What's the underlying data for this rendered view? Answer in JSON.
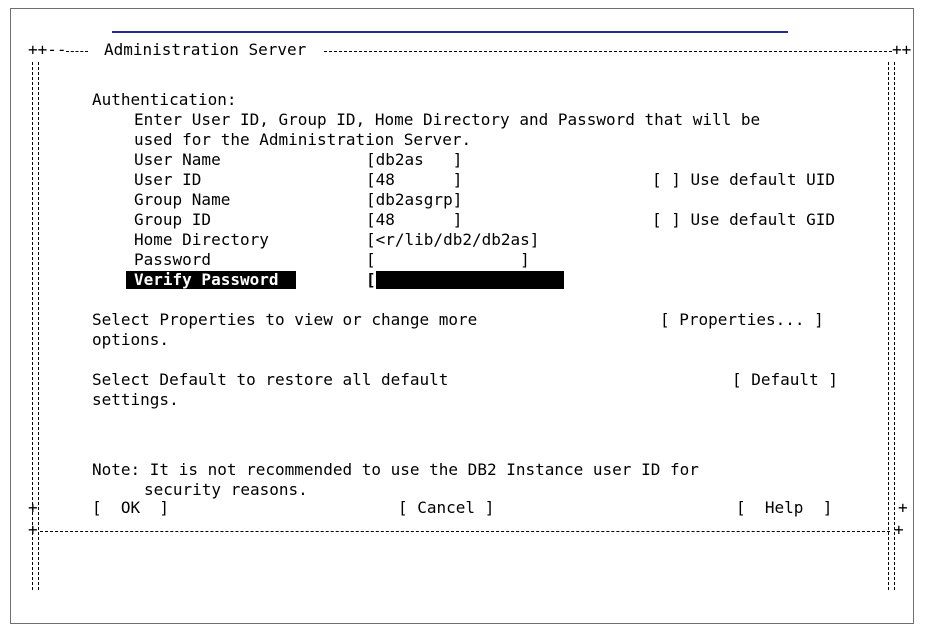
{
  "dialog": {
    "title": "Administration Server",
    "authentication": {
      "heading": "Authentication:",
      "description_line1": "Enter User ID, Group ID, Home Directory and Password that will be",
      "description_line2": "used for the Administration Server."
    },
    "fields": {
      "user_name": {
        "label": "User Name",
        "value": "[db2as   ]"
      },
      "user_id": {
        "label": "User ID",
        "value": "[48      ]"
      },
      "group_name": {
        "label": "Group Name",
        "value": "[db2asgrp]"
      },
      "group_id": {
        "label": "Group ID",
        "value": "[48      ]"
      },
      "home_directory": {
        "label": "Home Directory",
        "value": "[<r/lib/db2/db2as]"
      },
      "password": {
        "label": "Password",
        "value": "[               ]"
      },
      "verify_password": {
        "label": "Verify Password",
        "value": "[               ]"
      }
    },
    "checkboxes": {
      "default_uid": "[ ] Use default UID",
      "default_gid": "[ ] Use default GID"
    },
    "properties": {
      "text_line1": "Select Properties to view or change more",
      "text_line2": "options.",
      "button": "[ Properties... ]"
    },
    "default": {
      "text_line1": "Select Default to restore all default",
      "text_line2": "settings.",
      "button": "[ Default ]"
    },
    "note": {
      "line1": "Note: It is not recommended to use the DB2 Instance user ID for",
      "line2": "security reasons."
    },
    "buttons": {
      "ok": "[  OK  ]",
      "cancel": "[ Cancel ]",
      "help": "[  Help  ]"
    }
  }
}
